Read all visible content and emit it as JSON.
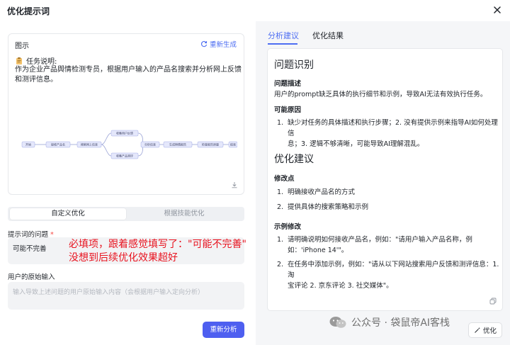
{
  "dialog": {
    "title": "优化提示词"
  },
  "illustration": {
    "header": "图示",
    "regenerate_label": "重新生成",
    "task_label": "任务说明:",
    "task_description": "作为企业产品舆情检测专员，根据用户输入的产品名搜索并分析网上反馈和测评信息。",
    "flow_nodes": [
      "开始",
      "接收产品名",
      "搜索网上信息",
      "收集用户反馈",
      "收集产品测评",
      "分析信息",
      "生成舆情报告",
      "检查报告质量",
      "结束"
    ]
  },
  "mode_tabs": {
    "custom": "自定义优化",
    "skill": "根据技能优化"
  },
  "problem": {
    "label": "提示词的问题",
    "required_mark": "*",
    "value": "可能不完善"
  },
  "overlay_note": {
    "line1": "必填项，跟着感觉填写了：\"可能不完善\"",
    "line2": "没想到后续优化效果超好"
  },
  "user_input": {
    "label": "用户的原始输入",
    "placeholder": "输入导致上述问题的用户原始输入内容（会根据用户输入定向分析）"
  },
  "reanalyze_label": "重新分析",
  "right_tabs": {
    "analysis": "分析建议",
    "result": "优化结果"
  },
  "analysis": {
    "h_problem": "问题识别",
    "sub_desc": "问题描述",
    "desc_text": "用户的prompt缺乏具体的执行细节和示例，导致AI无法有效执行任务。",
    "sub_cause": "可能原因",
    "cause_num": "1.",
    "cause_line1": "缺少对任务的具体描述和执行步骤；2. 没有提供示例来指导AI如何处理信",
    "cause_line2": "息；3. 逻辑不够清晰，可能导致AI理解混乱。",
    "h_suggest": "优化建议",
    "sub_points": "修改点",
    "points": [
      {
        "num": "1.",
        "text": "明确接收产品名的方式"
      },
      {
        "num": "2.",
        "text": "提供具体的搜索策略和示例"
      }
    ],
    "sub_example": "示例修改",
    "examples": [
      {
        "num": "1.",
        "line1": "请明确说明如何接收产品名，例如：\"请用户输入产品名称，例",
        "line2": "如：'iPhone 14'\"。"
      },
      {
        "num": "2.",
        "line1": "在任务中添加示例，例如：\"请从以下网站搜索用户反馈和测评信息：1. 淘",
        "line2": "宝评论 2. 京东评论 3. 社交媒体\"。"
      }
    ]
  },
  "watermark": {
    "text": "公众号 · 袋鼠帝AI客栈"
  },
  "optimize_label": "优化"
}
